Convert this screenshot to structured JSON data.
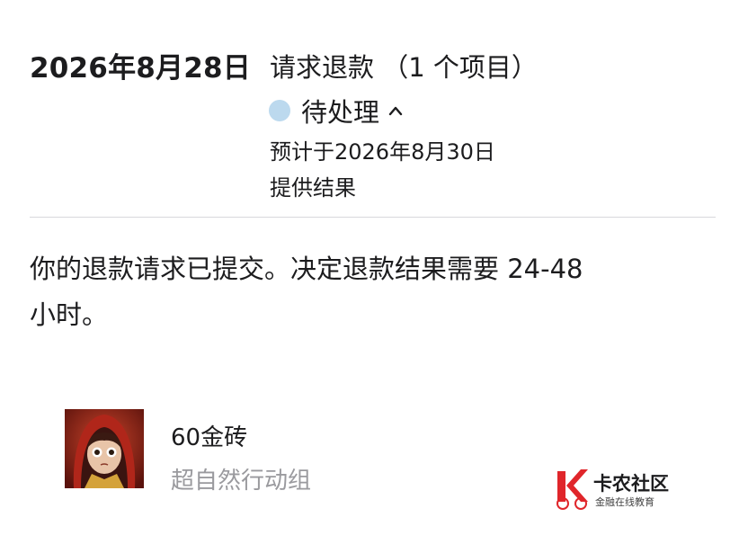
{
  "header": {
    "date": "2026年8月28日",
    "request_title": "请求退款 （1 个项目）"
  },
  "status": {
    "label": "待处理",
    "dot_color": "#bcd9ee",
    "expand_icon": "chevron-up-icon"
  },
  "expected": {
    "line1": "预计于2026年8月30日",
    "line2": "提供结果"
  },
  "message": {
    "line1": "你的退款请求已提交。决定退款结果需要 24-48",
    "line2": "小时。"
  },
  "item": {
    "name": "60金砖",
    "seller": "超自然行动组"
  },
  "watermark": {
    "title": "卡农社区",
    "subtitle": "金融在线教育",
    "accent_color": "#e0262b"
  }
}
